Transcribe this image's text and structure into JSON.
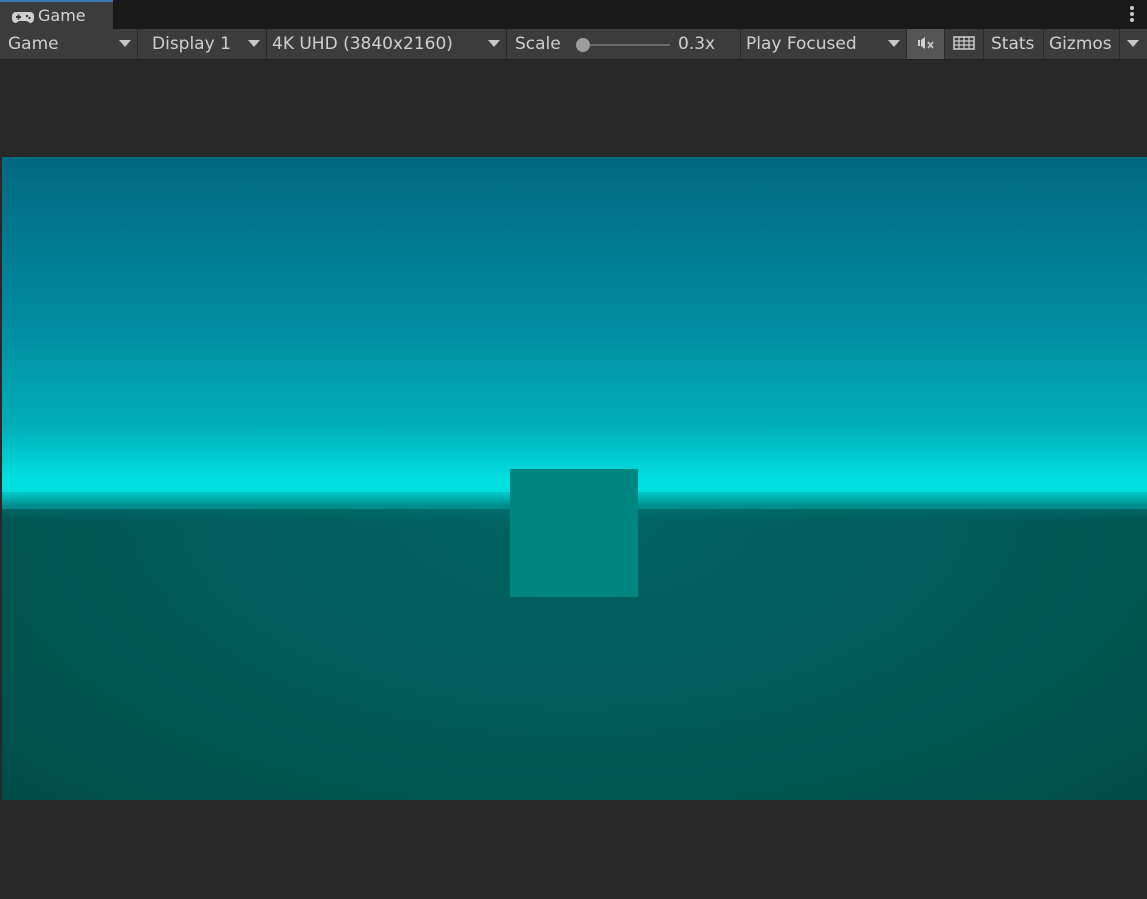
{
  "window": {
    "tab_label": "Game",
    "tab_icon": "gamepad-icon"
  },
  "toolbar": {
    "view_dropdown": "Game",
    "display_dropdown": "Display 1",
    "resolution_dropdown": "4K UHD (3840x2160)",
    "scale_label": "Scale",
    "scale_value": "0.3x",
    "scale_fraction": 0.0,
    "play_mode_dropdown": "Play Focused",
    "mute_icon": "mute-audio-icon",
    "stats_icon": "keyboard-grid-icon",
    "stats_label": "Stats",
    "gizmos_label": "Gizmos"
  },
  "colors": {
    "sky_top": "#00687f",
    "horizon": "#00e0e0",
    "ground": "#005c5a",
    "cube": "#008681",
    "editor_bg": "#282828",
    "toolbar_bg": "#3c3c3c",
    "tab_accent": "#3a79bb"
  }
}
